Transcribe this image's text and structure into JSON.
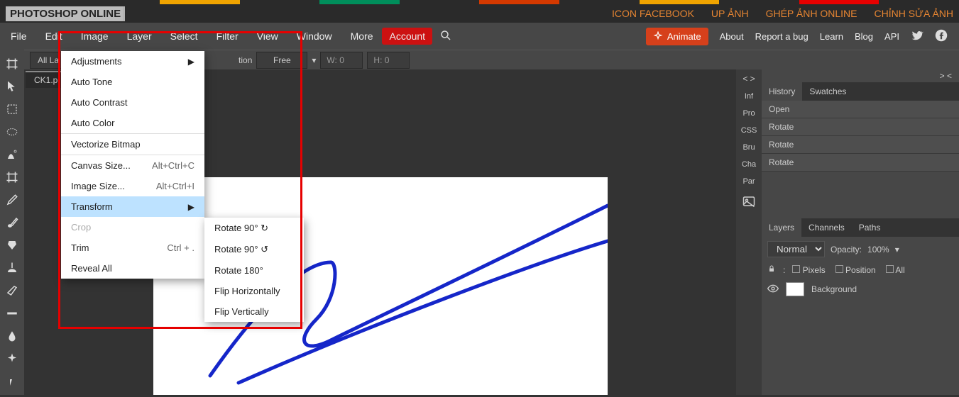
{
  "top_strip_colors": [
    "#2a2a2a",
    "#2a2a2a",
    "#f0a400",
    "#2a2a2a",
    "#008e5b",
    "#2a2a2a",
    "#d43900",
    "#2a2a2a",
    "#f0a400",
    "#2a2a2a",
    "#e60000",
    "#2a2a2a"
  ],
  "brand": "PHOTOSHOP ONLINE",
  "header_links": [
    "ICON FACEBOOK",
    "UP ẢNH",
    "GHÉP ẢNH ONLINE",
    "CHỈNH SỬA ẢNH"
  ],
  "menu": {
    "items": [
      "File",
      "Edit",
      "Image",
      "Layer",
      "Select",
      "Filter",
      "View",
      "Window",
      "More"
    ],
    "account": "Account"
  },
  "right_menu": {
    "animate": "Animate",
    "items": [
      "About",
      "Report a bug",
      "Learn",
      "Blog",
      "API"
    ]
  },
  "option_bar": {
    "layer_drop": "All La",
    "ratio_tail": "tion",
    "free": "Free",
    "w": "W: 0",
    "h": "H: 0"
  },
  "doc_tab": "CK1.p",
  "dropdown": {
    "items": [
      {
        "label": "Adjustments",
        "arrow": true
      },
      {
        "label": "Auto Tone"
      },
      {
        "label": "Auto Contrast"
      },
      {
        "label": "Auto Color"
      },
      {
        "sep": true
      },
      {
        "label": "Vectorize Bitmap"
      },
      {
        "sep": true
      },
      {
        "label": "Canvas Size...",
        "sc": "Alt+Ctrl+C"
      },
      {
        "label": "Image Size...",
        "sc": "Alt+Ctrl+I"
      },
      {
        "label": "Transform",
        "arrow": true,
        "highlight": true
      },
      {
        "label": "Crop",
        "disabled": true
      },
      {
        "label": "Trim",
        "sc": "Ctrl + ."
      },
      {
        "label": "Reveal All"
      }
    ]
  },
  "submenu": [
    "Rotate 90° ↻",
    "Rotate 90° ↺",
    "Rotate 180°",
    "Flip Horizontally",
    "Flip Vertically"
  ],
  "right_narrow": {
    "top": "< >",
    "items": [
      "Inf",
      "Pro",
      "CSS",
      "Bru",
      "Cha",
      "Par"
    ]
  },
  "history_panel": {
    "tabs": [
      "History",
      "Swatches"
    ],
    "items": [
      "Open",
      "Rotate",
      "Rotate",
      "Rotate"
    ]
  },
  "layers_panel": {
    "tabs": [
      "Layers",
      "Channels",
      "Paths"
    ],
    "blend": "Normal",
    "opacity_label": "Opacity:",
    "opacity": "100%",
    "lock_opts": [
      "Pixels",
      "Position",
      "All"
    ],
    "layer_name": "Background"
  },
  "right_nav_top": "> <"
}
